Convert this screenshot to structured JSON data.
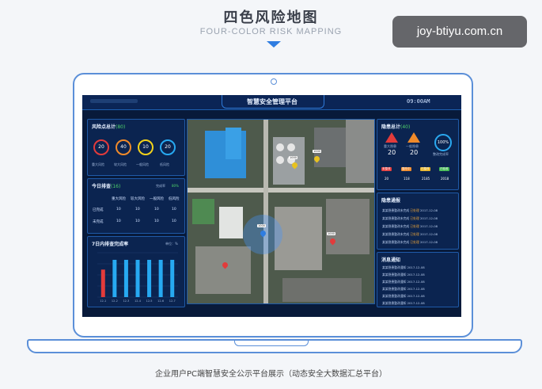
{
  "header": {
    "title": "四色风险地图",
    "subtitle": "FOUR-COLOR RISK MAPPING"
  },
  "watermark": "joy-btiyu.com.cn",
  "caption": "企业用户PC端智慧安全公示平台展示（动态安全大数据汇总平台）",
  "dashboard": {
    "system_name": "智慧安全管理平台",
    "clock": "09:00AM",
    "risk_panel": {
      "title": "风险点总计",
      "total": "(80)",
      "rings": [
        {
          "value": "20",
          "label": "重大风险",
          "color": "#e23b3b"
        },
        {
          "value": "40",
          "label": "较大风险",
          "color": "#f08a2a"
        },
        {
          "value": "10",
          "label": "一般风险",
          "color": "#f2d21b"
        },
        {
          "value": "20",
          "label": "低风险",
          "color": "#27a9f1"
        }
      ]
    },
    "check_panel": {
      "title": "今日排查",
      "count": "(16)",
      "rate_label": "完成率",
      "rate": "80%",
      "columns": [
        "",
        "重大风险",
        "较大风险",
        "一般风险",
        "低风险"
      ],
      "rows": [
        {
          "label": "已完成",
          "values": [
            "10",
            "10",
            "10",
            "10"
          ]
        },
        {
          "label": "未完成",
          "values": [
            "10",
            "10",
            "10",
            "10"
          ]
        }
      ]
    },
    "chart_panel": {
      "title": "7日内排查完成率",
      "unit": "单位：%"
    },
    "chart_data": {
      "type": "bar",
      "categories": [
        "12-1",
        "12-2",
        "12-3",
        "12-4",
        "12-5",
        "12-6",
        "12-7"
      ],
      "values": [
        62,
        84,
        84,
        84,
        84,
        84,
        84
      ],
      "colors": [
        "#e23b3b",
        "#27a9f1",
        "#27a9f1",
        "#27a9f1",
        "#27a9f1",
        "#27a9f1",
        "#27a9f1"
      ],
      "ylim": [
        0,
        100
      ]
    },
    "hazard_panel": {
      "title": "隐患总计",
      "total": "(40)",
      "stats": [
        {
          "label": "重大隐患",
          "value": "20",
          "color": "#e23b3b"
        },
        {
          "label": "一般隐患",
          "value": "20",
          "color": "#f08a2a"
        }
      ],
      "rate_value": "100%",
      "rate_label": "整改完成率",
      "tags": [
        {
          "label": "未整改",
          "value": "20",
          "color": "#e23b3b"
        },
        {
          "label": "整改中",
          "value": "118",
          "color": "#f08a2a"
        },
        {
          "label": "已整改",
          "value": "2185",
          "color": "#e8b424"
        },
        {
          "label": "已验收",
          "value": "2018",
          "color": "#3fb950"
        }
      ]
    },
    "notice_panel": {
      "title": "隐患通报",
      "rows": [
        {
          "text": "某某隐患整改未完成",
          "tag": "已处理",
          "date": "2017-12-08"
        },
        {
          "text": "某某隐患整改未完成",
          "tag": "已处理",
          "date": "2017-12-08"
        },
        {
          "text": "某某隐患整改未完成",
          "tag": "已处理",
          "date": "2017-12-08"
        },
        {
          "text": "某某隐患整改未完成",
          "tag": "已处理",
          "date": "2017-12-08"
        },
        {
          "text": "某某隐患整改未完成",
          "tag": "已处理",
          "date": "2017-12-08"
        }
      ]
    },
    "alert_panel": {
      "title": "消息通知",
      "rows": [
        {
          "text": "某某隐患整改通知",
          "date": "2017-12-08"
        },
        {
          "text": "某某隐患整改通知",
          "date": "2017-12-08"
        },
        {
          "text": "某某隐患整改通知",
          "date": "2017-12-08"
        },
        {
          "text": "某某隐患整改通知",
          "date": "2017-12-08"
        },
        {
          "text": "某某隐患整改通知",
          "date": "2017-12-08"
        },
        {
          "text": "某某隐患整改通知",
          "date": "2017-12-08"
        }
      ]
    },
    "map_labels": [
      "1000",
      "1000",
      "1000",
      "1000"
    ]
  }
}
